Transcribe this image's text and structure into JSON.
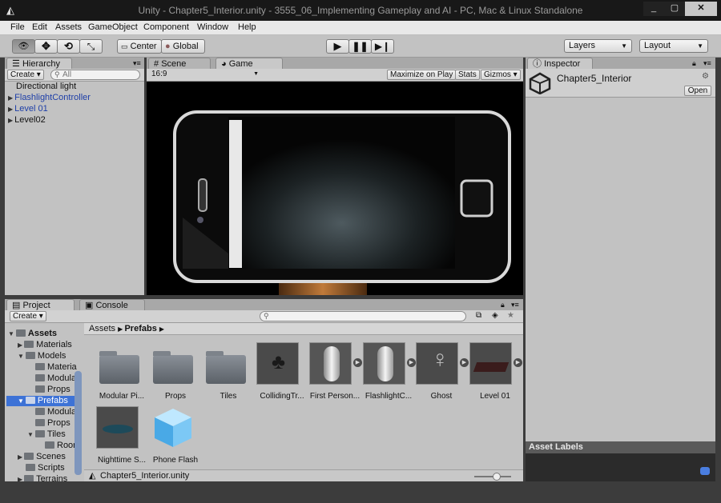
{
  "window": {
    "title": "Unity - Chapter5_Interior.unity - 3555_06_Implementing Gameplay and AI - PC, Mac & Linux Standalone"
  },
  "menu": [
    "File",
    "Edit",
    "Assets",
    "GameObject",
    "Component",
    "Window",
    "Help"
  ],
  "toolbar": {
    "pivot": "Center",
    "space": "Global",
    "layers": "Layers",
    "layout": "Layout"
  },
  "hierarchy": {
    "tab": "Hierarchy",
    "create": "Create",
    "search_placeholder": "All",
    "items": [
      {
        "label": "Directional light"
      },
      {
        "label": "FlashlightController"
      },
      {
        "label": "Level 01"
      },
      {
        "label": "Level02"
      }
    ]
  },
  "scene_tabs": {
    "scene": "Scene",
    "game": "Game"
  },
  "game_toolbar": {
    "aspect": "16:9",
    "maximize": "Maximize on Play",
    "stats": "Stats",
    "gizmos": "Gizmos"
  },
  "inspector": {
    "tab": "Inspector",
    "object": "Chapter5_Interior",
    "open": "Open",
    "labels_header": "Asset Labels"
  },
  "project": {
    "tab": "Project",
    "console_tab": "Console",
    "create": "Create",
    "breadcrumb": [
      "Assets",
      "Prefabs"
    ],
    "tree": [
      "Assets",
      "Materials",
      "Models",
      "Materia",
      "Modula",
      "Props",
      "Prefabs",
      "Modula",
      "Props",
      "Tiles",
      "Roor",
      "Scenes",
      "Scripts",
      "Terrains"
    ],
    "assets": [
      {
        "label": "Modular Pi..."
      },
      {
        "label": "Props"
      },
      {
        "label": "Tiles"
      },
      {
        "label": "CollidingTr..."
      },
      {
        "label": "First Person..."
      },
      {
        "label": "FlashlightC..."
      },
      {
        "label": "Ghost"
      },
      {
        "label": "Level 01"
      },
      {
        "label": "Nighttime S..."
      },
      {
        "label": "Phone Flash"
      }
    ],
    "footer": "Chapter5_Interior.unity"
  }
}
